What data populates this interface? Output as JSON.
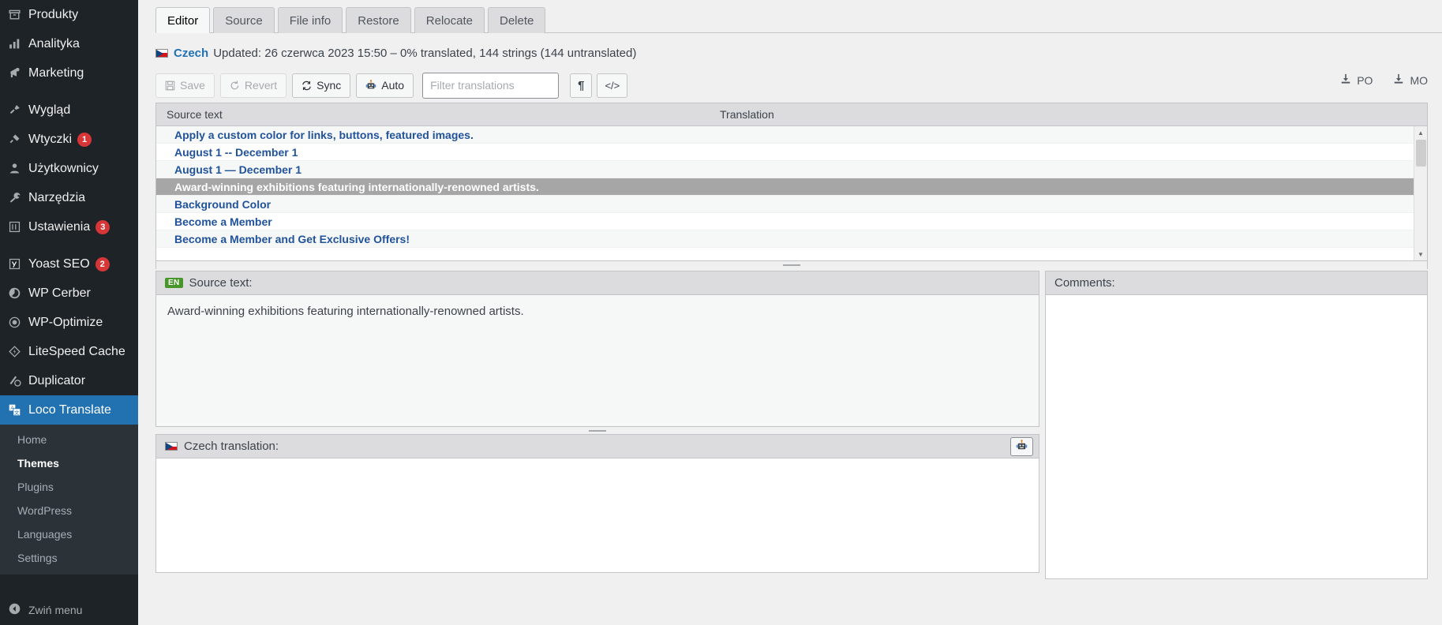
{
  "sidebar": {
    "items": [
      {
        "label": "Produkty",
        "icon": "products-icon",
        "badge": null
      },
      {
        "label": "Analityka",
        "icon": "analytics-icon",
        "badge": null
      },
      {
        "label": "Marketing",
        "icon": "marketing-icon",
        "badge": null
      },
      {
        "label": "Wygląd",
        "icon": "appearance-icon",
        "badge": null
      },
      {
        "label": "Wtyczki",
        "icon": "plugins-icon",
        "badge": "1"
      },
      {
        "label": "Użytkownicy",
        "icon": "users-icon",
        "badge": null
      },
      {
        "label": "Narzędzia",
        "icon": "tools-icon",
        "badge": null
      },
      {
        "label": "Ustawienia",
        "icon": "settings-icon",
        "badge": "3"
      },
      {
        "label": "Yoast SEO",
        "icon": "yoast-icon",
        "badge": "2"
      },
      {
        "label": "WP Cerber",
        "icon": "cerber-icon",
        "badge": null
      },
      {
        "label": "WP-Optimize",
        "icon": "optimize-icon",
        "badge": null
      },
      {
        "label": "LiteSpeed Cache",
        "icon": "litespeed-icon",
        "badge": null
      },
      {
        "label": "Duplicator",
        "icon": "duplicator-icon",
        "badge": null
      },
      {
        "label": "Loco Translate",
        "icon": "loco-translate-icon",
        "badge": null
      }
    ],
    "submenu": [
      {
        "label": "Home",
        "active": false
      },
      {
        "label": "Themes",
        "active": true
      },
      {
        "label": "Plugins",
        "active": false
      },
      {
        "label": "WordPress",
        "active": false
      },
      {
        "label": "Languages",
        "active": false
      },
      {
        "label": "Settings",
        "active": false
      }
    ],
    "collapse_label": "Zwiń menu"
  },
  "tabs": [
    {
      "label": "Editor",
      "active": true
    },
    {
      "label": "Source",
      "active": false
    },
    {
      "label": "File info",
      "active": false
    },
    {
      "label": "Restore",
      "active": false
    },
    {
      "label": "Relocate",
      "active": false
    },
    {
      "label": "Delete",
      "active": false
    }
  ],
  "status": {
    "language": "Czech",
    "text": "Updated: 26 czerwca 2023 15:50 – 0% translated, 144 strings (144 untranslated)"
  },
  "toolbar": {
    "save_label": "Save",
    "revert_label": "Revert",
    "sync_label": "Sync",
    "auto_label": "Auto",
    "filter_placeholder": "Filter translations",
    "filter_value": "",
    "invisibles_label": "¶",
    "code_label": "</>",
    "po_label": "PO",
    "mo_label": "MO"
  },
  "table": {
    "col_source": "Source text",
    "col_translation": "Translation",
    "rows": [
      {
        "source": "Apply a custom color for links, buttons, featured images.",
        "translation": "",
        "selected": false
      },
      {
        "source": "August 1 -- December 1",
        "translation": "",
        "selected": false
      },
      {
        "source": "August 1 — December 1",
        "translation": "",
        "selected": false
      },
      {
        "source": "Award-winning exhibitions featuring internationally-renowned artists.",
        "translation": "",
        "selected": true
      },
      {
        "source": "Background Color",
        "translation": "",
        "selected": false
      },
      {
        "source": "Become a Member",
        "translation": "",
        "selected": false
      },
      {
        "source": "Become a Member and Get Exclusive Offers!",
        "translation": "",
        "selected": false
      }
    ]
  },
  "detail": {
    "source_badge": "EN",
    "source_heading": "Source text:",
    "source_value": "Award-winning exhibitions featuring internationally-renowned artists.",
    "translation_heading": "Czech translation:",
    "translation_value": "",
    "comments_heading": "Comments:",
    "comments_value": ""
  },
  "colors": {
    "accent": "#2271b1",
    "badge": "#d63638",
    "sidebar_bg": "#1d2327",
    "submenu_bg": "#2c3338",
    "link": "#21539b",
    "selected_row": "#a6a6a6",
    "en_badge": "#46962b"
  }
}
